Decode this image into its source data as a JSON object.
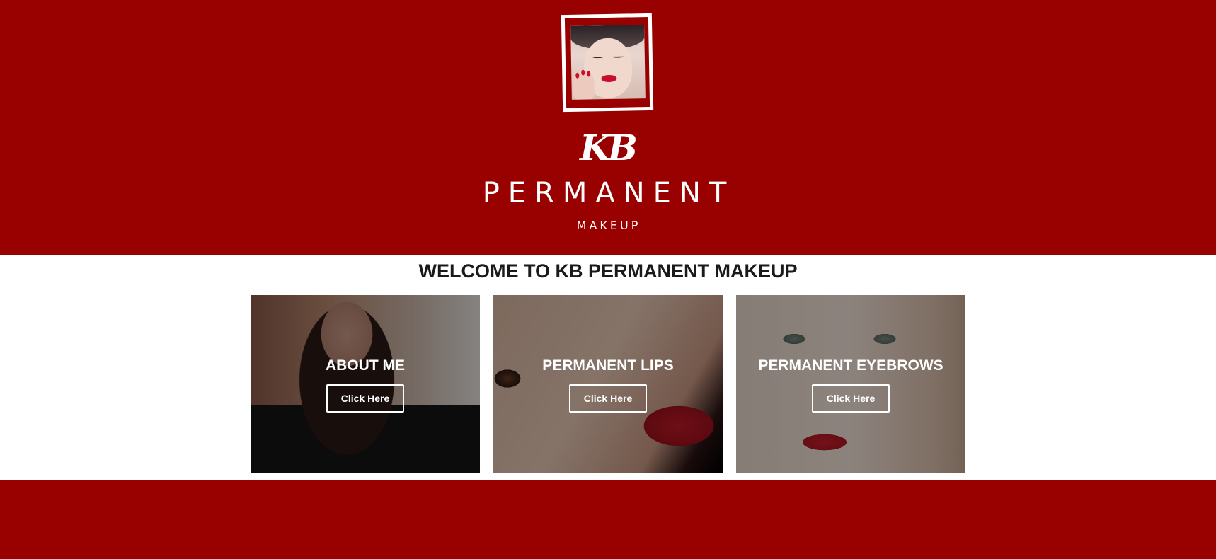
{
  "brand": {
    "logo_initials": "KB",
    "logo_word": "PERMANENT",
    "logo_sub": "MAKEUP",
    "primary_color": "#990000"
  },
  "main": {
    "title": "WELCOME TO KB PERMANENT MAKEUP",
    "cards": [
      {
        "title": "ABOUT ME",
        "button_label": "Click Here"
      },
      {
        "title": "PERMANENT LIPS",
        "button_label": "Click Here"
      },
      {
        "title": "PERMANENT EYEBROWS",
        "button_label": "Click Here"
      }
    ]
  }
}
